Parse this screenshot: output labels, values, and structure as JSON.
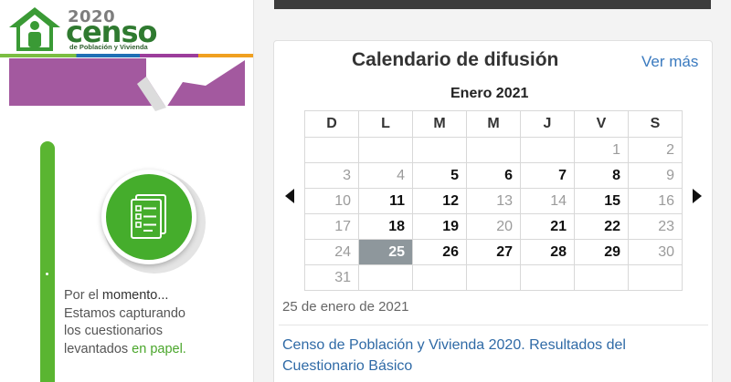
{
  "brand": {
    "year": "2020",
    "word": "censo",
    "tagline": "de Población y Vivienda",
    "colors": {
      "green": "#2f7a30",
      "accent_green": "#45ad2c",
      "purple": "#a3599f",
      "blue": "#1f6fb5",
      "orange": "#f0a020"
    }
  },
  "status_panel": {
    "icon": "document-checklist-icon",
    "line_prefix": "Por el ",
    "line_emphasis": "momento...",
    "line2": "Estamos capturando",
    "line3": "los cuestionarios",
    "line4_prefix": "levantados ",
    "line4_highlight": "en papel."
  },
  "calendar": {
    "title": "Calendario de difusión",
    "more_link": "Ver más",
    "month": "Enero 2021",
    "prev_icon": "arrow-left-icon",
    "next_icon": "arrow-right-icon",
    "weekdays": [
      "D",
      "L",
      "M",
      "M",
      "J",
      "V",
      "S"
    ],
    "weeks": [
      [
        "",
        "",
        "",
        "",
        "",
        "1",
        "2"
      ],
      [
        "3",
        "4",
        "5",
        "6",
        "7",
        "8",
        "9"
      ],
      [
        "10",
        "11",
        "12",
        "13",
        "14",
        "15",
        "16"
      ],
      [
        "17",
        "18",
        "19",
        "20",
        "21",
        "22",
        "23"
      ],
      [
        "24",
        "25",
        "26",
        "27",
        "28",
        "29",
        "30"
      ],
      [
        "31",
        "",
        "",
        "",
        "",
        "",
        ""
      ]
    ],
    "event_days": [
      "5",
      "6",
      "7",
      "8",
      "11",
      "12",
      "15",
      "18",
      "19",
      "21",
      "22",
      "26",
      "27",
      "28",
      "29"
    ],
    "selected_day": "25",
    "selected_date_text": "25 de enero de 2021",
    "event_title": "Censo de Población y Vivienda 2020. Resultados del Cuestionario Básico"
  }
}
